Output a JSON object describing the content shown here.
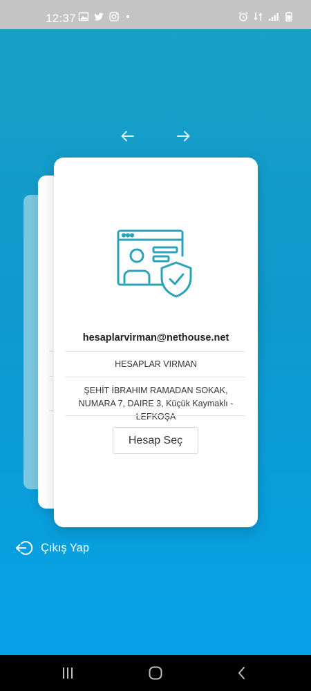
{
  "status_bar": {
    "time": "12:37",
    "left_icons": [
      "gallery-icon",
      "twitter-icon",
      "instagram-icon",
      "notification-dot-icon"
    ],
    "right_icons": [
      "alarm-icon",
      "data-indicator-icon",
      "signal-icon",
      "battery-icon"
    ]
  },
  "navigation": {
    "prev_icon": "arrow-left-icon",
    "next_icon": "arrow-right-icon"
  },
  "account_card": {
    "illustration_icon": "verified-profile-shield-icon",
    "email": "hesaplarvirman@nethouse.net",
    "name": "HESAPLAR VIRMAN",
    "address": "ŞEHİT İBRAHIM RAMADAN SOKAK, NUMARA 7, DAIRE 3, Küçük Kaymaklı - LEFKOŞA",
    "select_button_label": "Hesap Seç"
  },
  "logout": {
    "icon": "logout-icon",
    "label": "Çıkış Yap"
  },
  "system_nav": {
    "recent_icon": "recent-apps-icon",
    "home_icon": "home-icon",
    "back_icon": "back-chevron-icon"
  },
  "colors": {
    "background_top": "#1aa0c6",
    "background_bottom": "#05a2ea",
    "illustration_teal": "#2aa3b9",
    "status_bar": "#c4c4c4"
  }
}
